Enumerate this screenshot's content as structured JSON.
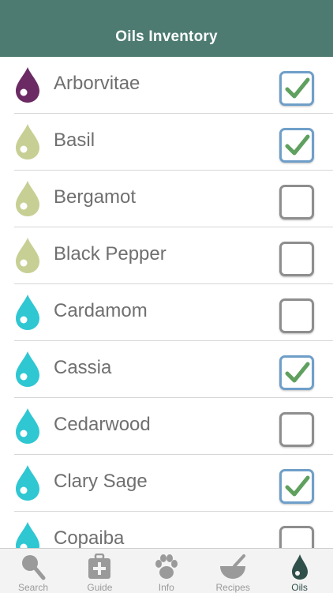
{
  "header": {
    "title": "Oils Inventory"
  },
  "oils": [
    {
      "name": "Arborvitae",
      "color": "#6b2a63",
      "checked": true
    },
    {
      "name": "Basil",
      "color": "#c8cf94",
      "checked": true
    },
    {
      "name": "Bergamot",
      "color": "#c8cf94",
      "checked": false
    },
    {
      "name": "Black Pepper",
      "color": "#c8cf94",
      "checked": false
    },
    {
      "name": "Cardamom",
      "color": "#2ec7d2",
      "checked": false
    },
    {
      "name": "Cassia",
      "color": "#2ec7d2",
      "checked": true
    },
    {
      "name": "Cedarwood",
      "color": "#2ec7d2",
      "checked": false
    },
    {
      "name": "Clary Sage",
      "color": "#2ec7d2",
      "checked": true
    },
    {
      "name": "Copaiba",
      "color": "#2ec7d2",
      "checked": false
    }
  ],
  "tabs": [
    {
      "label": "Search",
      "icon": "search-icon",
      "active": false
    },
    {
      "label": "Guide",
      "icon": "first-aid-kit-icon",
      "active": false
    },
    {
      "label": "Info",
      "icon": "paw-icon",
      "active": false
    },
    {
      "label": "Recipes",
      "icon": "mortar-bowl-icon",
      "active": false
    },
    {
      "label": "Oils",
      "icon": "oil-drop-icon",
      "active": true
    }
  ],
  "colors": {
    "header": "#4d7b71",
    "check_mark": "#5fa05f",
    "check_on_border": "#6f9fc9",
    "tab_active": "#2f4f4a",
    "tab_inactive": "#9a9a9a"
  }
}
